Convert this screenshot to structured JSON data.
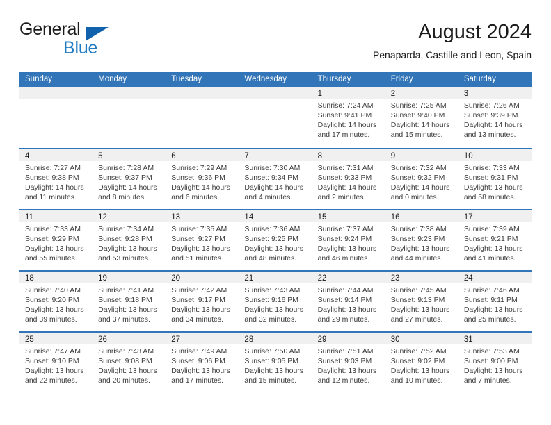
{
  "brand": {
    "name_part1": "General",
    "name_part2": "Blue",
    "triangle_color": "#1062ad",
    "blue_color": "#1f7bc4"
  },
  "header": {
    "title": "August 2024",
    "subtitle": "Penaparda, Castille and Leon, Spain"
  },
  "theme": {
    "header_blue": "#3275b8",
    "day_band_gray": "#f0f0f0",
    "text_dark": "#1b1b1b",
    "text_body": "#3c3c3c"
  },
  "weekday_headers": [
    "Sunday",
    "Monday",
    "Tuesday",
    "Wednesday",
    "Thursday",
    "Friday",
    "Saturday"
  ],
  "weeks": [
    [
      {
        "num": "",
        "lines": []
      },
      {
        "num": "",
        "lines": []
      },
      {
        "num": "",
        "lines": []
      },
      {
        "num": "",
        "lines": []
      },
      {
        "num": "1",
        "lines": [
          "Sunrise: 7:24 AM",
          "Sunset: 9:41 PM",
          "Daylight: 14 hours",
          "and 17 minutes."
        ]
      },
      {
        "num": "2",
        "lines": [
          "Sunrise: 7:25 AM",
          "Sunset: 9:40 PM",
          "Daylight: 14 hours",
          "and 15 minutes."
        ]
      },
      {
        "num": "3",
        "lines": [
          "Sunrise: 7:26 AM",
          "Sunset: 9:39 PM",
          "Daylight: 14 hours",
          "and 13 minutes."
        ]
      }
    ],
    [
      {
        "num": "4",
        "lines": [
          "Sunrise: 7:27 AM",
          "Sunset: 9:38 PM",
          "Daylight: 14 hours",
          "and 11 minutes."
        ]
      },
      {
        "num": "5",
        "lines": [
          "Sunrise: 7:28 AM",
          "Sunset: 9:37 PM",
          "Daylight: 14 hours",
          "and 8 minutes."
        ]
      },
      {
        "num": "6",
        "lines": [
          "Sunrise: 7:29 AM",
          "Sunset: 9:36 PM",
          "Daylight: 14 hours",
          "and 6 minutes."
        ]
      },
      {
        "num": "7",
        "lines": [
          "Sunrise: 7:30 AM",
          "Sunset: 9:34 PM",
          "Daylight: 14 hours",
          "and 4 minutes."
        ]
      },
      {
        "num": "8",
        "lines": [
          "Sunrise: 7:31 AM",
          "Sunset: 9:33 PM",
          "Daylight: 14 hours",
          "and 2 minutes."
        ]
      },
      {
        "num": "9",
        "lines": [
          "Sunrise: 7:32 AM",
          "Sunset: 9:32 PM",
          "Daylight: 14 hours",
          "and 0 minutes."
        ]
      },
      {
        "num": "10",
        "lines": [
          "Sunrise: 7:33 AM",
          "Sunset: 9:31 PM",
          "Daylight: 13 hours",
          "and 58 minutes."
        ]
      }
    ],
    [
      {
        "num": "11",
        "lines": [
          "Sunrise: 7:33 AM",
          "Sunset: 9:29 PM",
          "Daylight: 13 hours",
          "and 55 minutes."
        ]
      },
      {
        "num": "12",
        "lines": [
          "Sunrise: 7:34 AM",
          "Sunset: 9:28 PM",
          "Daylight: 13 hours",
          "and 53 minutes."
        ]
      },
      {
        "num": "13",
        "lines": [
          "Sunrise: 7:35 AM",
          "Sunset: 9:27 PM",
          "Daylight: 13 hours",
          "and 51 minutes."
        ]
      },
      {
        "num": "14",
        "lines": [
          "Sunrise: 7:36 AM",
          "Sunset: 9:25 PM",
          "Daylight: 13 hours",
          "and 48 minutes."
        ]
      },
      {
        "num": "15",
        "lines": [
          "Sunrise: 7:37 AM",
          "Sunset: 9:24 PM",
          "Daylight: 13 hours",
          "and 46 minutes."
        ]
      },
      {
        "num": "16",
        "lines": [
          "Sunrise: 7:38 AM",
          "Sunset: 9:23 PM",
          "Daylight: 13 hours",
          "and 44 minutes."
        ]
      },
      {
        "num": "17",
        "lines": [
          "Sunrise: 7:39 AM",
          "Sunset: 9:21 PM",
          "Daylight: 13 hours",
          "and 41 minutes."
        ]
      }
    ],
    [
      {
        "num": "18",
        "lines": [
          "Sunrise: 7:40 AM",
          "Sunset: 9:20 PM",
          "Daylight: 13 hours",
          "and 39 minutes."
        ]
      },
      {
        "num": "19",
        "lines": [
          "Sunrise: 7:41 AM",
          "Sunset: 9:18 PM",
          "Daylight: 13 hours",
          "and 37 minutes."
        ]
      },
      {
        "num": "20",
        "lines": [
          "Sunrise: 7:42 AM",
          "Sunset: 9:17 PM",
          "Daylight: 13 hours",
          "and 34 minutes."
        ]
      },
      {
        "num": "21",
        "lines": [
          "Sunrise: 7:43 AM",
          "Sunset: 9:16 PM",
          "Daylight: 13 hours",
          "and 32 minutes."
        ]
      },
      {
        "num": "22",
        "lines": [
          "Sunrise: 7:44 AM",
          "Sunset: 9:14 PM",
          "Daylight: 13 hours",
          "and 29 minutes."
        ]
      },
      {
        "num": "23",
        "lines": [
          "Sunrise: 7:45 AM",
          "Sunset: 9:13 PM",
          "Daylight: 13 hours",
          "and 27 minutes."
        ]
      },
      {
        "num": "24",
        "lines": [
          "Sunrise: 7:46 AM",
          "Sunset: 9:11 PM",
          "Daylight: 13 hours",
          "and 25 minutes."
        ]
      }
    ],
    [
      {
        "num": "25",
        "lines": [
          "Sunrise: 7:47 AM",
          "Sunset: 9:10 PM",
          "Daylight: 13 hours",
          "and 22 minutes."
        ]
      },
      {
        "num": "26",
        "lines": [
          "Sunrise: 7:48 AM",
          "Sunset: 9:08 PM",
          "Daylight: 13 hours",
          "and 20 minutes."
        ]
      },
      {
        "num": "27",
        "lines": [
          "Sunrise: 7:49 AM",
          "Sunset: 9:06 PM",
          "Daylight: 13 hours",
          "and 17 minutes."
        ]
      },
      {
        "num": "28",
        "lines": [
          "Sunrise: 7:50 AM",
          "Sunset: 9:05 PM",
          "Daylight: 13 hours",
          "and 15 minutes."
        ]
      },
      {
        "num": "29",
        "lines": [
          "Sunrise: 7:51 AM",
          "Sunset: 9:03 PM",
          "Daylight: 13 hours",
          "and 12 minutes."
        ]
      },
      {
        "num": "30",
        "lines": [
          "Sunrise: 7:52 AM",
          "Sunset: 9:02 PM",
          "Daylight: 13 hours",
          "and 10 minutes."
        ]
      },
      {
        "num": "31",
        "lines": [
          "Sunrise: 7:53 AM",
          "Sunset: 9:00 PM",
          "Daylight: 13 hours",
          "and 7 minutes."
        ]
      }
    ]
  ]
}
